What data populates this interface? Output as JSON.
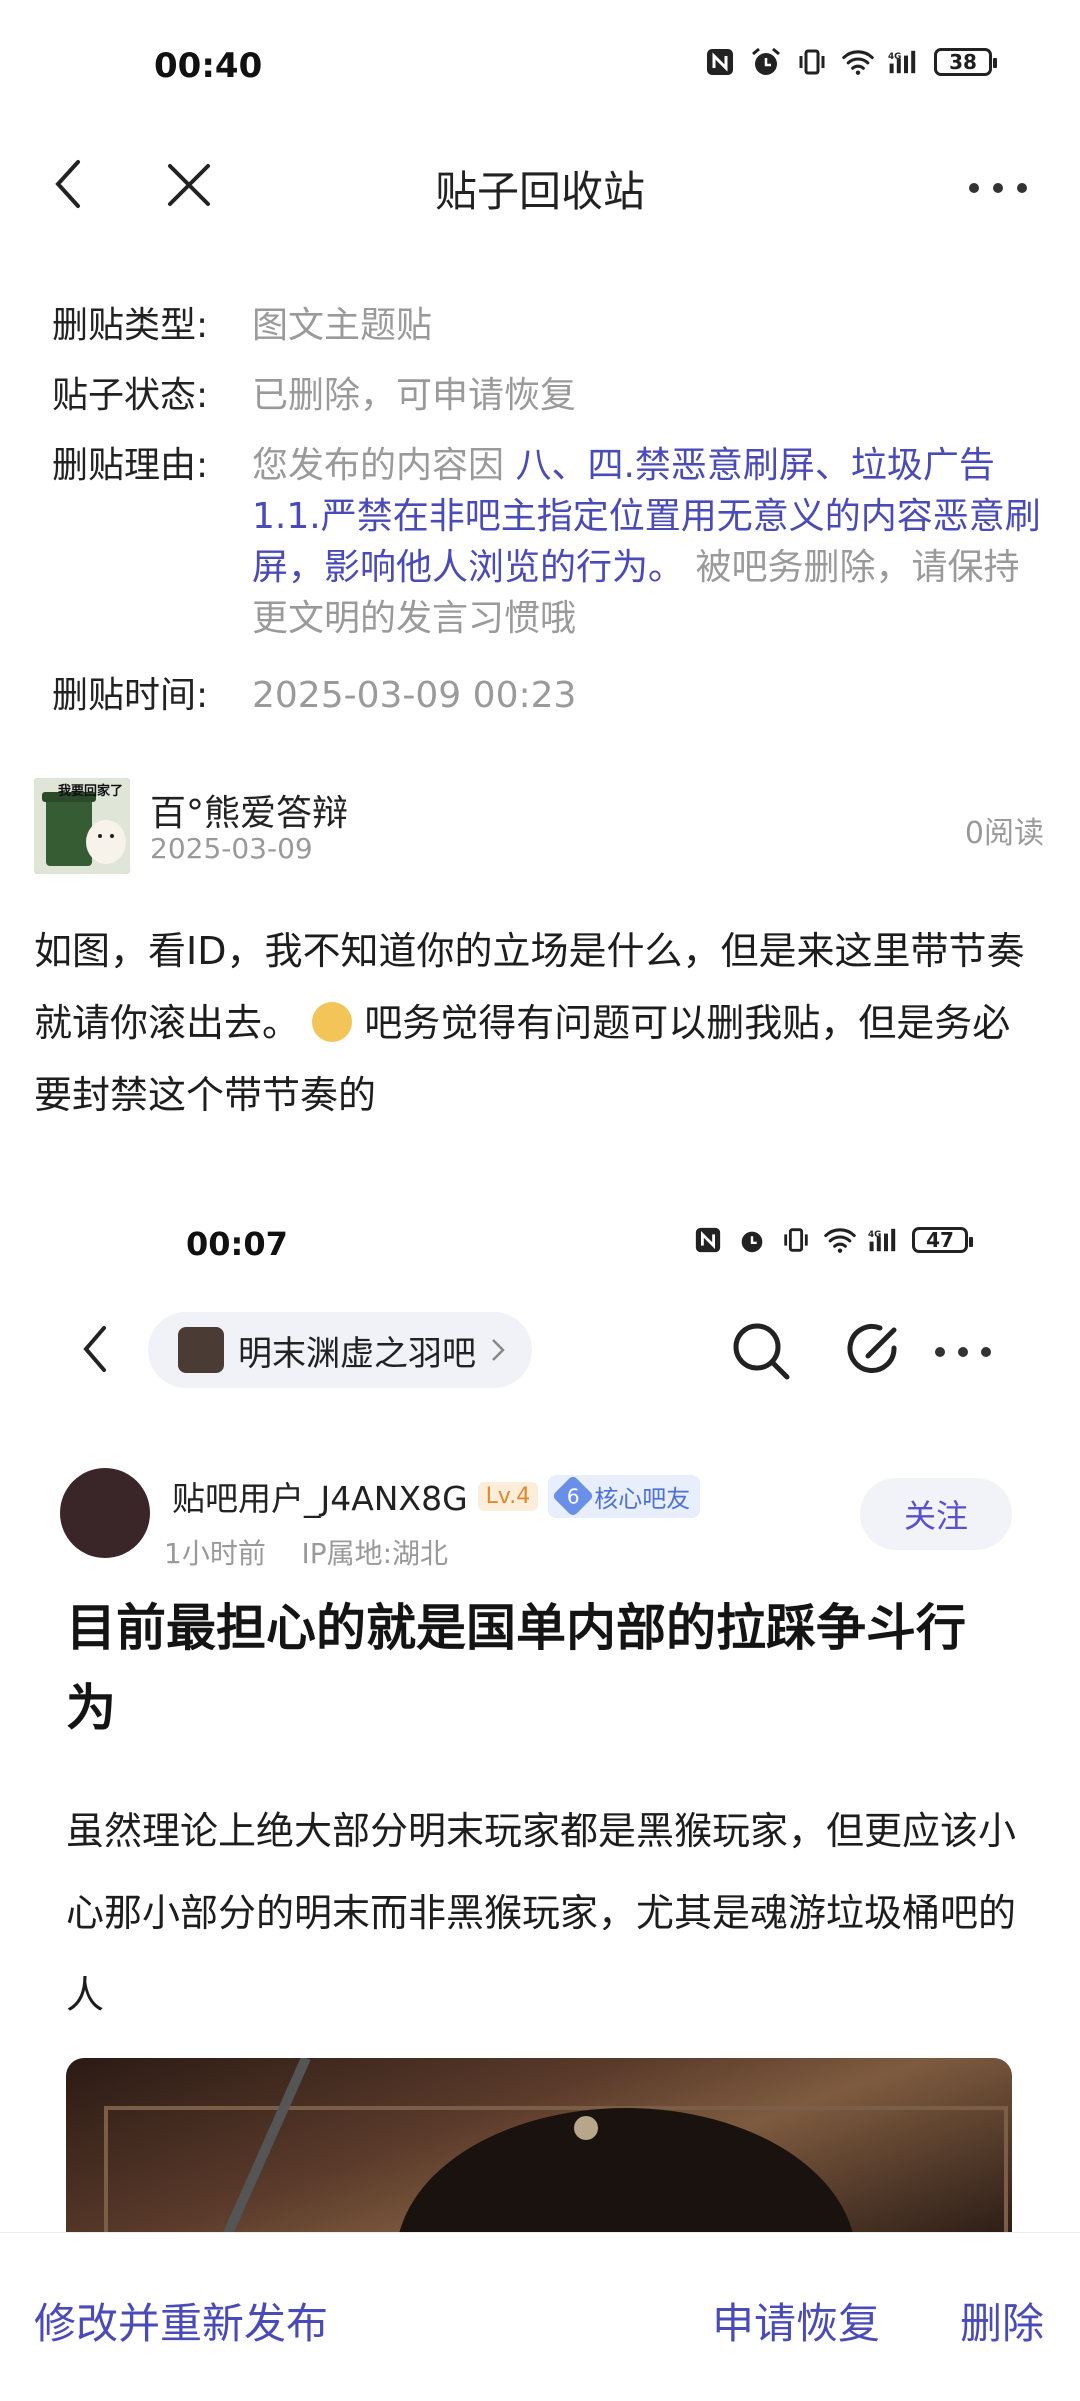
{
  "status": {
    "time": "00:40",
    "battery": "38"
  },
  "nav": {
    "title": "贴子回收站"
  },
  "info": {
    "type_label": "删贴类型:",
    "type_value": "图文主题贴",
    "status_label": "贴子状态:",
    "status_value": "已删除，可申请恢复",
    "reason_label": "删贴理由:",
    "reason_prefix": "您发布的内容因",
    "reason_rule": "八、四.禁恶意刷屏、垃圾广告 1.1.严禁在非吧主指定位置用无意义的内容恶意刷屏，影响他人浏览的行为。",
    "reason_suffix": "被吧务删除，请保持更文明的发言习惯哦",
    "time_label": "删贴时间:",
    "time_value": "2025-03-09 00:23"
  },
  "post": {
    "avatar_caption": "我要回家了",
    "username": "百°熊爱答辩",
    "date": "2025-03-09",
    "reads": "0阅读",
    "body_part1": "如图，看ID，我不知道你的立场是什么，但是来这里带节奏就请你滚出去。",
    "body_part2": "吧务觉得有问题可以删我贴，但是务必要封禁这个带节奏的"
  },
  "embedded": {
    "time": "00:07",
    "battery": "47",
    "forum_name": "明末渊虚之羽吧",
    "username": "贴吧用户_J4ANX8G",
    "level": "Lv.4",
    "core_num": "6",
    "core_label": "核心吧友",
    "meta_time": "1小时前",
    "meta_ip": "IP属地:湖北",
    "follow": "关注",
    "title": "目前最担心的就是国单内部的拉踩争斗行为",
    "body": "虽然理论上绝大部分明末玩家都是黑猴玩家，但更应该小心那小部分的明末而非黑猴玩家，尤其是魂游垃圾桶吧的人"
  },
  "bottom": {
    "edit_republish": "修改并重新发布",
    "restore": "申请恢复",
    "delete": "删除"
  },
  "colors": {
    "accent": "#4a4ab8",
    "muted": "#9a9a9a"
  }
}
